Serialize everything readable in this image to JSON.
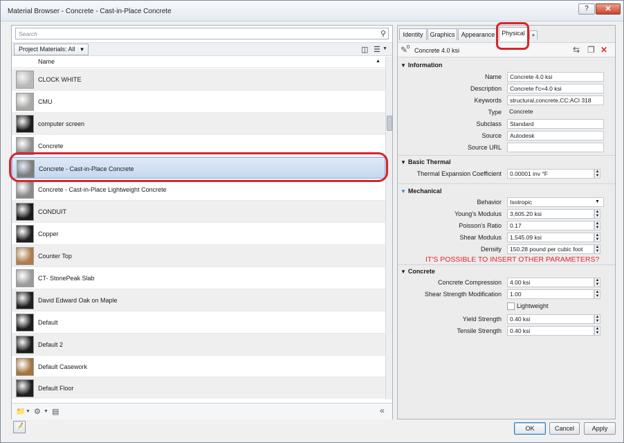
{
  "window": {
    "title": "Material Browser - Concrete - Cast-in-Place Concrete",
    "help_label": "?",
    "close_label": "✕"
  },
  "browser": {
    "search_placeholder": "Search",
    "filter_label": "Project Materials: All",
    "column_name": "Name",
    "materials": [
      {
        "name": "CLOCK WHITE",
        "swatch": "#b9b9b9"
      },
      {
        "name": "CMU",
        "swatch": "#a8a8a4"
      },
      {
        "name": "computer screen",
        "swatch": "#1c1c1c"
      },
      {
        "name": "Concrete",
        "swatch": "#8f8f8f"
      },
      {
        "name": "Concrete - Cast-in-Place Concrete",
        "swatch": "#7d7d7d"
      },
      {
        "name": "Concrete - Cast-in-Place Lightweight Concrete",
        "swatch": "#8a8a8a"
      },
      {
        "name": "CONDUIT",
        "swatch": "#1a1a1a"
      },
      {
        "name": "Copper",
        "swatch": "#1e1e1e"
      },
      {
        "name": "Counter Top",
        "swatch": "#b07b4a"
      },
      {
        "name": "CT- StonePeak Slab",
        "swatch": "#9a9a9a"
      },
      {
        "name": "David Edward Oak on Maple",
        "swatch": "#1f1f1f"
      },
      {
        "name": "Default",
        "swatch": "#1d1d1d"
      },
      {
        "name": "Default 2",
        "swatch": "#1d1d1d"
      },
      {
        "name": "Default Casework",
        "swatch": "#a4743f"
      },
      {
        "name": "Default Floor",
        "swatch": "#1f1f1f"
      }
    ],
    "selected_index": 4
  },
  "tabs": {
    "items": [
      "Identity",
      "Graphics",
      "Appearance",
      "Physical"
    ],
    "add_label": "+",
    "active": "Physical"
  },
  "asset": {
    "count": "0",
    "name": "Concrete 4.0 ksi"
  },
  "sections": {
    "information": {
      "title": "Information",
      "name_label": "Name",
      "name_value": "Concrete 4.0 ksi",
      "description_label": "Description",
      "description_value": "Concrete f'c=4.0 ksi",
      "keywords_label": "Keywords",
      "keywords_value": "structural,concrete,CC:ACI 318",
      "type_label": "Type",
      "type_value": "Concrete",
      "subclass_label": "Subclass",
      "subclass_value": "Standard",
      "source_label": "Source",
      "source_value": "Autodesk",
      "source_url_label": "Source URL",
      "source_url_value": ""
    },
    "thermal": {
      "title": "Basic Thermal",
      "expansion_label": "Thermal Expansion Coefficient",
      "expansion_value": "0.00001 inv °F"
    },
    "mechanical": {
      "title": "Mechanical",
      "behavior_label": "Behavior",
      "behavior_value": "Isotropic",
      "youngs_label": "Young's Modulus",
      "youngs_value": "3,605.20 ksi",
      "poissons_label": "Poisson's Ratio",
      "poissons_value": "0.17",
      "shear_label": "Shear Modulus",
      "shear_value": "1,545.09 ksi",
      "density_label": "Density",
      "density_value": "150.28 pound per cubic foot"
    },
    "annotation": "IT'S POSSIBLE TO INSERT OTHER  PARAMETERS?",
    "concrete": {
      "title": "Concrete",
      "compression_label": "Concrete Compression",
      "compression_value": "4.00 ksi",
      "shear_mod_label": "Shear Strength Modification",
      "shear_mod_value": "1.00",
      "lightweight_label": "Lightweight",
      "yield_label": "Yield Strength",
      "yield_value": "0.40 ksi",
      "tensile_label": "Tensile Strength",
      "tensile_value": "0.40 ksi"
    }
  },
  "buttons": {
    "ok": "OK",
    "cancel": "Cancel",
    "apply": "Apply"
  },
  "colors": {
    "highlight": "#d9232b",
    "selection": "#c6d8ef"
  }
}
